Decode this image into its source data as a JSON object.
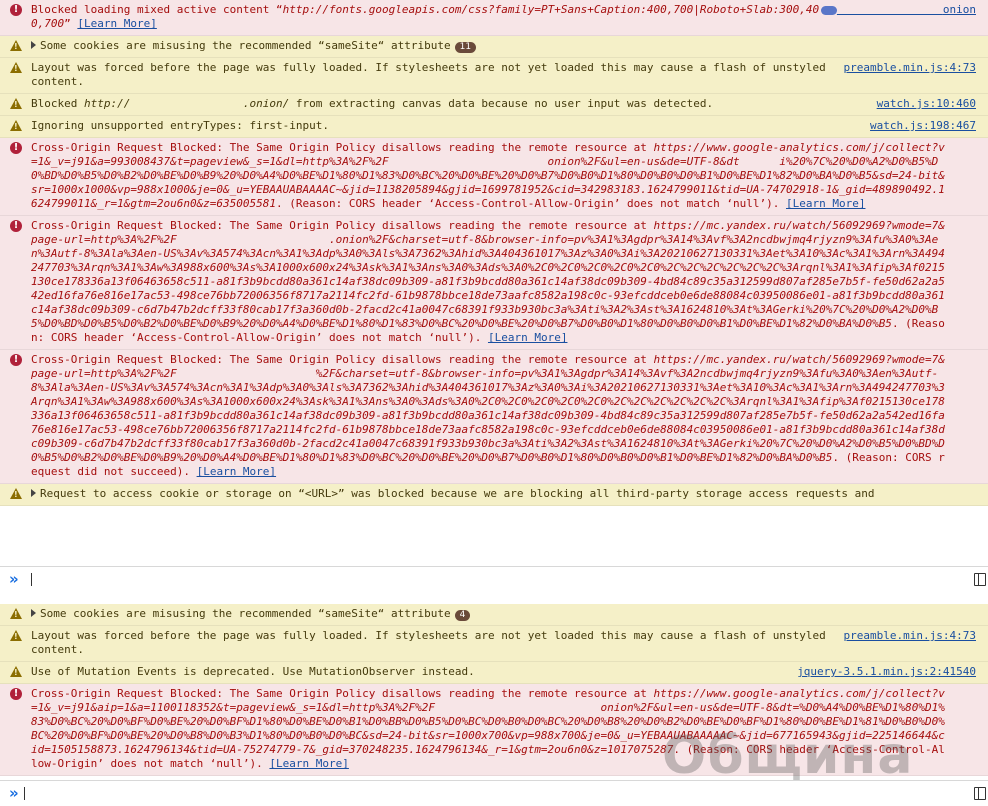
{
  "panel1": {
    "messages": [
      {
        "type": "error",
        "text": "Blocked loading mixed active content “",
        "url": "http://fonts.googleapis.com/css?family=PT+Sans+Caption:400,700|Roboto+Slab:300,400,700",
        "after": "”",
        "learn": "[Learn More]",
        "source": "onion"
      },
      {
        "type": "warn",
        "text": "Some cookies are misusing the recommended “sameSite“ attribute",
        "count": "11"
      },
      {
        "type": "warn",
        "text": "Layout was forced before the page was fully loaded. If stylesheets are not yet loaded this may cause a flash of unstyled content.",
        "source": "preamble.min.js:4:73"
      },
      {
        "type": "warn",
        "text": "Blocked ",
        "url": "http://                 .onion/",
        "after": " from extracting canvas data because no user input was detected.",
        "source": "watch.js:10:460"
      },
      {
        "type": "warn",
        "text": "Ignoring unsupported entryTypes: first-input.",
        "source": "watch.js:198:467"
      },
      {
        "type": "error",
        "text": "Cross-Origin Request Blocked: The Same Origin Policy disallows reading the remote resource at ",
        "url": "https://www.google-analytics.com/j/collect?v=1&_v=j91&a=993008437&t=pageview&_s=1&dl=http%3A%2F%2F                        onion%2F&ul=en-us&de=UTF-8&dt      i%20%7C%20%D0%A2%D0%B5%D0%BD%D0%B5%D0%B2%D0%BE%D0%B9%20%D0%A4%D0%BE%D1%80%D1%83%D0%BC%20%D0%BE%20%D0%B7%D0%B0%D1%80%D0%B0%D0%B1%D0%BE%D1%82%D0%BA%D0%B5&sd=24-bit&sr=1000x1000&vp=988x1000&je=0&_u=YEBAAUABAAAAC~&jid=1138205894&gjid=1699781952&cid=342983183.1624799011&tid=UA-74702918-1&_gid=489890492.1624799011&_r=1&gtm=2ou6n0&z=635005581",
        "after": ". (Reason: CORS header ‘Access-Control-Allow-Origin’ does not match ‘null’). ",
        "learn": "[Learn More]"
      },
      {
        "type": "error",
        "text": "Cross-Origin Request Blocked: The Same Origin Policy disallows reading the remote resource at ",
        "url": "https://mc.yandex.ru/watch/56092969?wmode=7&page-url=http%3A%2F%2F                       .onion%2F&charset=utf-8&browser-info=pv%3A1%3Agdpr%3A14%3Avf%3A2ncdbwjmq4rjyzn9%3Afu%3A0%3Aen%3Autf-8%3Ala%3Aen-US%3Av%3A574%3Acn%3A1%3Adp%3A0%3Als%3A7362%3Ahid%3A404361017%3Az%3A0%3Ai%3A20210627130331%3Aet%3A10%3Ac%3A1%3Arn%3A494247703%3Arqn%3A1%3Aw%3A988x600%3As%3A1000x600x24%3Ask%3A1%3Ans%3A0%3Ads%3A0%2C0%2C0%2C0%2C0%2C0%2C%2C%2C%2C%2C%2C%3Arqnl%3A1%3Afip%3Af0215130ce178336a13f06463658c511-a81f3b9bcdd80a361c14af38dc09b309-a81f3b9bcdd80a361c14af38dc09b309-4bd84c89c35a312599d807af285e7b5f-fe50d62a2a542ed16fa76e816e17ac53-498ce76bb72006356f8717a2114fc2fd-61b9878bbce18de73aafc8582a198c0c-93efcddceb0e6de88084c03950086e01-a81f3b9bcdd80a361c14af38dc09b309-c6d7b47b2dcff33f80cab17f3a360d0b-2facd2c41a0047c68391f933b930bc3a%3Ati%3A2%3Ast%3A1624810%3At%3AGerki%20%7C%20%D0%A2%D0%B5%D0%BD%D0%B5%D0%B2%D0%BE%D0%B9%20%D0%A4%D0%BE%D1%80%D1%83%D0%BC%20%D0%BE%20%D0%B7%D0%B0%D1%80%D0%B0%D0%B1%D0%BE%D1%82%D0%BA%D0%B5",
        "after": ". (Reason: CORS header ‘Access-Control-Allow-Origin’ does not match ‘null’). ",
        "learn": "[Learn More]"
      },
      {
        "type": "error",
        "text": "Cross-Origin Request Blocked: The Same Origin Policy disallows reading the remote resource at ",
        "url": "https://mc.yandex.ru/watch/56092969?wmode=7&page-url=http%3A%2F%2F                     %2F&charset=utf-8&browser-info=pv%3A1%3Agdpr%3A14%3Avf%3A2ncdbwjmq4rjyzn9%3Afu%3A0%3Aen%3Autf-8%3Ala%3Aen-US%3Av%3A574%3Acn%3A1%3Adp%3A0%3Als%3A7362%3Ahid%3A404361017%3Az%3A0%3Ai%3A20210627130331%3Aet%3A10%3Ac%3A1%3Arn%3A494247703%3Arqn%3A1%3Aw%3A988x600%3As%3A1000x600x24%3Ask%3A1%3Ans%3A0%3Ads%3A0%2C0%2C0%2C0%2C0%2C0%2C%2C%2C%2C%2C%2C%3Arqnl%3A1%3Afip%3Af0215130ce178336a13f06463658c511-a81f3b9bcdd80a361c14af38dc09b309-a81f3b9bcdd80a361c14af38dc09b309-4bd84c89c35a312599d807af285e7b5f-fe50d62a2a542ed16fa76e816e17ac53-498ce76bb72006356f8717a2114fc2fd-61b9878bbce18de73aafc8582a198c0c-93efcddceb0e6de88084c03950086e01-a81f3b9bcdd80a361c14af38dc09b309-c6d7b47b2dcff33f80cab17f3a360d0b-2facd2c41a0047c68391f933b930bc3a%3Ati%3A2%3Ast%3A1624810%3At%3AGerki%20%7C%20%D0%A2%D0%B5%D0%BD%D0%B5%D0%B2%D0%BE%D0%B9%20%D0%A4%D0%BE%D1%80%D1%83%D0%BC%20%D0%BE%20%D0%B7%D0%B0%D1%80%D0%B0%D0%B1%D0%BE%D1%82%D0%BA%D0%B5",
        "after": ". (Reason: CORS request did not succeed). ",
        "learn": "[Learn More]"
      },
      {
        "type": "warn",
        "text": "Request to access cookie or storage on “<URL>” was blocked because we are blocking all third-party storage access requests and"
      }
    ]
  },
  "panel2": {
    "messages": [
      {
        "type": "warn",
        "text": "Some cookies are misusing the recommended “sameSite“ attribute",
        "count": "4"
      },
      {
        "type": "warn",
        "text": "Layout was forced before the page was fully loaded. If stylesheets are not yet loaded this may cause a flash of unstyled content.",
        "source": "preamble.min.js:4:73"
      },
      {
        "type": "warn",
        "text": "Use of Mutation Events is deprecated. Use MutationObserver instead.",
        "source": "jquery-3.5.1.min.js:2:41540"
      },
      {
        "type": "error",
        "text": "Cross-Origin Request Blocked: The Same Origin Policy disallows reading the remote resource at ",
        "url": "https://www.google-analytics.com/j/collect?v=1&_v=j91&aip=1&a=1100118352&t=pageview&_s=1&dl=http%3A%2F%2F                         onion%2F&ul=en-us&de=UTF-8&dt=%D0%A4%D0%BE%D1%80%D1%83%D0%BC%20%D0%BF%D0%BE%20%D0%BF%D1%80%D0%BE%D0%B1%D0%BB%D0%B5%D0%BC%D0%B0%D0%BC%20%D0%B8%20%D0%B2%D0%BE%D0%BF%D1%80%D0%BE%D1%81%D0%B0%D0%BC%20%D0%BF%D0%BE%20%D0%B8%D0%B3%D1%80%D0%B0%D0%BC&sd=24-bit&sr=1000x700&vp=988x700&je=0&_u=YEBAAUABAAAAAC~&jid=677165943&gjid=225146644&cid=1505158873.1624796134&tid=UA-75274779-7&_gid=370248235.1624796134&_r=1&gtm=2ou6n0&z=1017075287",
        "after": ". (Reason: CORS header ‘Access-Control-Allow-Origin’ does not match ‘null’). ",
        "learn": "[Learn More]"
      }
    ]
  },
  "watermark": "Община"
}
